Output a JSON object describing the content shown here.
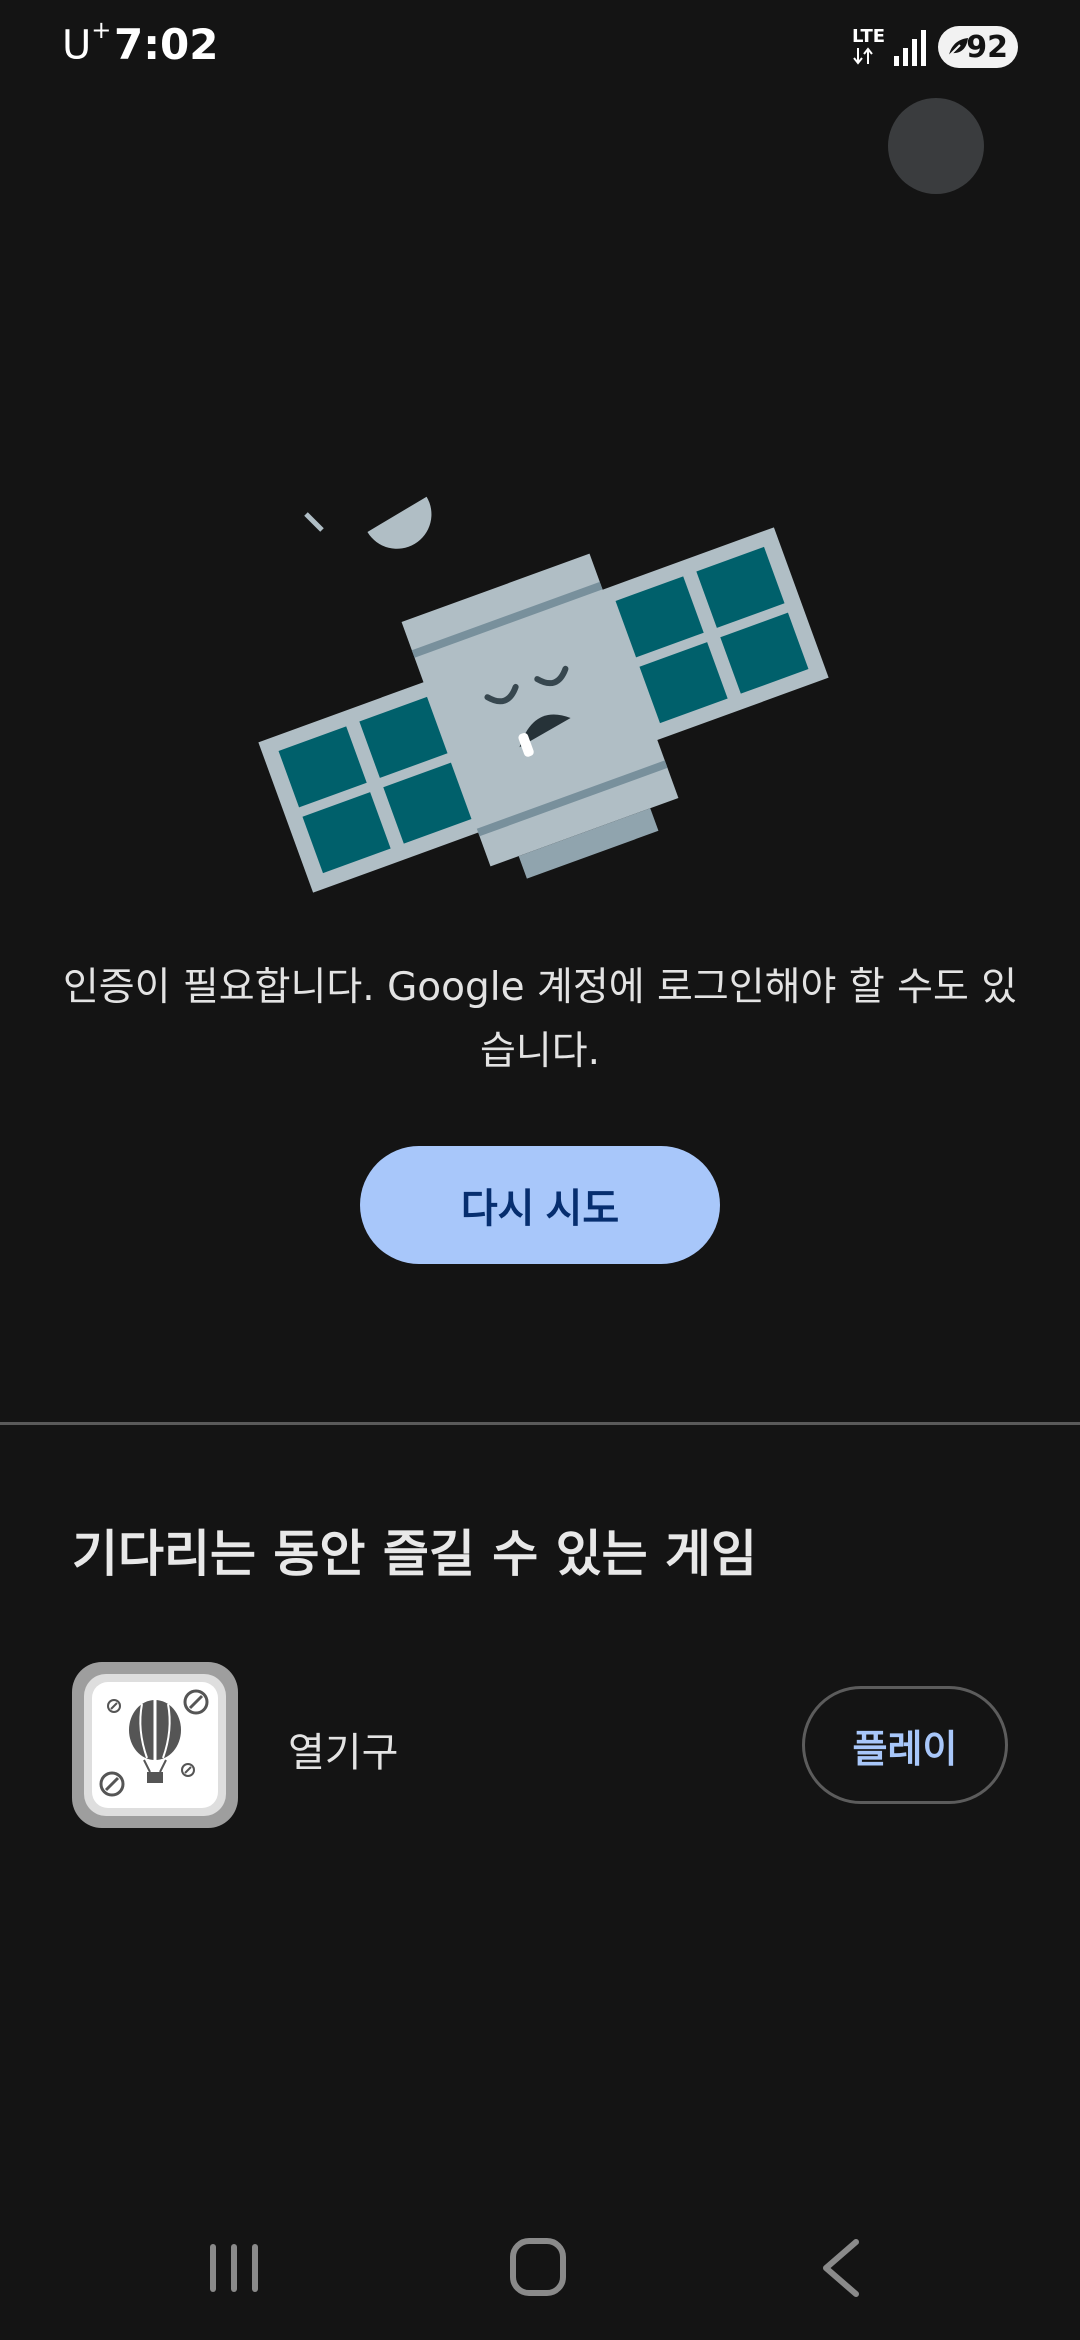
{
  "status_bar": {
    "carrier": "U",
    "carrier_plus": "+",
    "time": "7:02",
    "network": "LTE",
    "battery": "92"
  },
  "error": {
    "message": "인증이 필요합니다. Google 계정에 로그인해야 할 수도 있습니다.",
    "retry_label": "다시 시도",
    "illustration": "sleeping-satellite"
  },
  "games": {
    "title": "기다리는 동안 즐길 수 있는 게임",
    "items": [
      {
        "name": "열기구",
        "icon": "hot-air-balloon-icon",
        "play_label": "플레이"
      }
    ]
  },
  "colors": {
    "background": "#141414",
    "accent": "#a8c7fa",
    "accent_text": "#062e6f",
    "panel_teal": "#00606b",
    "satellite_body": "#b0bec5"
  }
}
